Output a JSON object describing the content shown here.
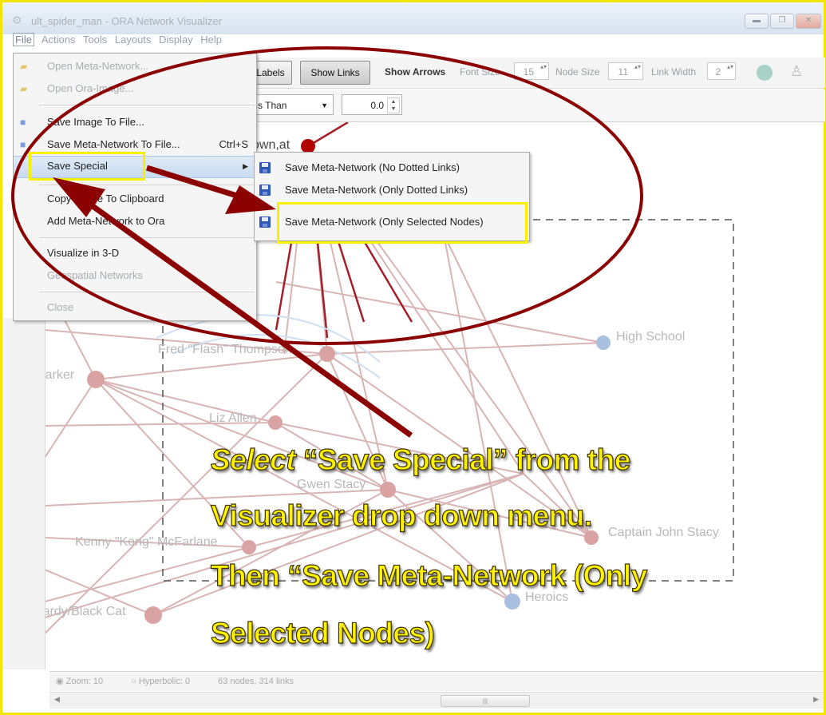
{
  "window": {
    "title": "ult_spider_man - ORA Network Visualizer",
    "controls": [
      "▬",
      "❐",
      "✕"
    ]
  },
  "menubar": {
    "items": [
      "File",
      "Actions",
      "Tools",
      "Layouts",
      "Display",
      "Help"
    ]
  },
  "toolbar": {
    "labels_button": "Labels",
    "show_links_button": "Show Links",
    "show_arrows_label": "Show Arrows",
    "font_size_label": "Font Size",
    "font_size_value": "15",
    "node_size_label": "Node Size",
    "node_size_value": "11",
    "link_width_label": "Link Width",
    "link_width_value": "2"
  },
  "filter": {
    "comparator": "s Than",
    "value": "0.0"
  },
  "file_menu": {
    "items": [
      {
        "label": "Open Meta-Network...",
        "shortcut": "",
        "disabled": true
      },
      {
        "label": "Open Ora-Image...",
        "shortcut": "",
        "disabled": true
      },
      {
        "label": "Save Image To File...",
        "shortcut": "",
        "disabled": false
      },
      {
        "label": "Save Meta-Network To File...",
        "shortcut": "Ctrl+S",
        "disabled": false
      },
      {
        "label": "Save Special",
        "shortcut": "",
        "disabled": false
      },
      {
        "label": "Copy Image To Clipboard",
        "shortcut": "",
        "disabled": false
      },
      {
        "label": "Add Meta-Network to Ora",
        "shortcut": "",
        "disabled": false
      },
      {
        "label": "Visualize in 3-D",
        "shortcut": "",
        "disabled": false
      },
      {
        "label": "Geospatial Networks",
        "shortcut": "",
        "disabled": true
      },
      {
        "label": "Close",
        "shortcut": "",
        "disabled": true
      }
    ]
  },
  "save_special_submenu": {
    "items": [
      {
        "label": "Save Meta-Network (No Dotted Links)"
      },
      {
        "label": "Save Meta-Network (Only Dotted Links)"
      },
      {
        "label": "Save Meta-Network (Only Selected Nodes)"
      }
    ]
  },
  "graph": {
    "nodes": [
      {
        "label": "Fred \"Flash\" Thompson",
        "color": "#d9a3a3"
      },
      {
        "label": "High School",
        "color": "#a9bfe0"
      },
      {
        "label": "Parker",
        "color": "#d9a3a3"
      },
      {
        "label": "Liz Allen",
        "color": "#d9a3a3"
      },
      {
        "label": "Gwen Stacy",
        "color": "#d9a3a3"
      },
      {
        "label": "Kenny \"Kong\" McFarlane",
        "color": "#d9a3a3"
      },
      {
        "label": "Captain John Stacy",
        "color": "#d9a3a3"
      },
      {
        "label": "Heroics",
        "color": "#a9bfe0"
      },
      {
        "label": "Hardy/Black Cat",
        "color": "#d9a3a3"
      },
      {
        "label": "own,at",
        "color": "#b00000"
      }
    ]
  },
  "status": {
    "zoom_label": "Zoom: 10",
    "hyperbolic_label": "Hyperbolic: 0",
    "counts": "63 nodes, 314 links"
  },
  "caption": {
    "select_word": "Select",
    "line1_rest": "“Save Special” from the",
    "line2": "Visualizer drop down menu.",
    "line3": "Then “Save Meta-Network (Only",
    "line4": "Selected Nodes)"
  },
  "colors": {
    "highlight_yellow": "#f7f000",
    "annotation_red": "#8b0000",
    "link_red": "#c98a8a",
    "node_blue": "#a9bfe0"
  }
}
